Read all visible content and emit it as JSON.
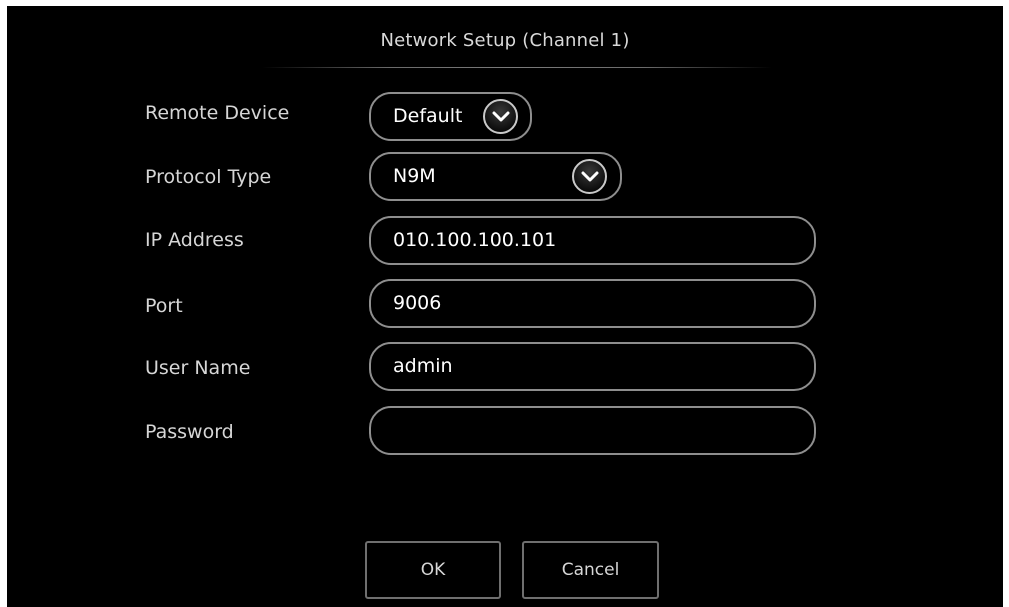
{
  "dialog": {
    "title": "Network Setup (Channel 1)"
  },
  "fields": {
    "remote_device": {
      "label": "Remote Device",
      "value": "Default"
    },
    "protocol_type": {
      "label": "Protocol Type",
      "value": "N9M"
    },
    "ip_address": {
      "label": "IP Address",
      "value": "010.100.100.101"
    },
    "port": {
      "label": "Port",
      "value": "9006"
    },
    "user_name": {
      "label": "User Name",
      "value": "admin"
    },
    "password": {
      "label": "Password",
      "value": ""
    }
  },
  "buttons": {
    "ok": "OK",
    "cancel": "Cancel"
  },
  "icons": {
    "dropdown": "chevron-down-icon"
  },
  "colors": {
    "background": "#000000",
    "text": "#d6d6d6",
    "border": "#8e8e8e"
  }
}
